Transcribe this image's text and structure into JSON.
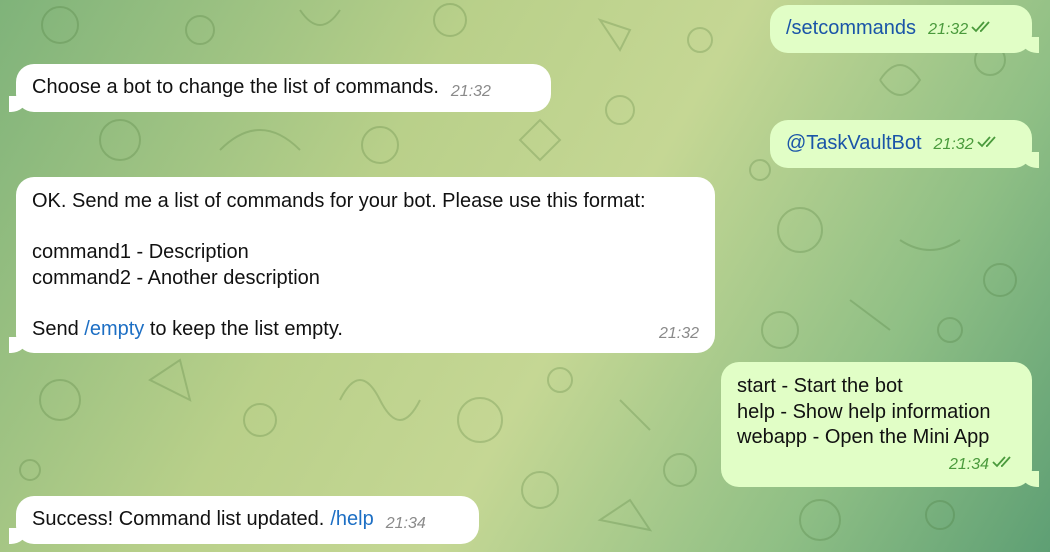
{
  "colors": {
    "incoming_bubble": "#ffffff",
    "outgoing_bubble": "#e1fec6",
    "link": "#1d6fc4",
    "outgoing_time": "#4a9a3c",
    "incoming_time": "#8a8a8a"
  },
  "messages": [
    {
      "id": "m1",
      "direction": "out",
      "command": "/setcommands",
      "time": "21:32",
      "status": "read-double-check-icon"
    },
    {
      "id": "m2",
      "direction": "in",
      "text": "Choose a bot to change the list of commands.",
      "time": "21:32"
    },
    {
      "id": "m3",
      "direction": "out",
      "command": "@TaskVaultBot",
      "time": "21:32",
      "status": "read-double-check-icon"
    },
    {
      "id": "m4",
      "direction": "in",
      "line1": "OK. Send me a list of commands for your bot. Please use this format:",
      "line2": "command1 - Description",
      "line3": "command2 - Another description",
      "line4_prefix": "Send",
      "line4_link": "/empty",
      "line4_suffix": "to keep the list empty.",
      "time": "21:32"
    },
    {
      "id": "m5",
      "direction": "out",
      "line1": "start - Start the bot",
      "line2": "help - Show help information",
      "line3": "webapp - Open the Mini App",
      "time": "21:34",
      "status": "read-double-check-icon"
    },
    {
      "id": "m6",
      "direction": "in",
      "text": "Success! Command list updated.",
      "link": "/help",
      "time": "21:34"
    }
  ]
}
